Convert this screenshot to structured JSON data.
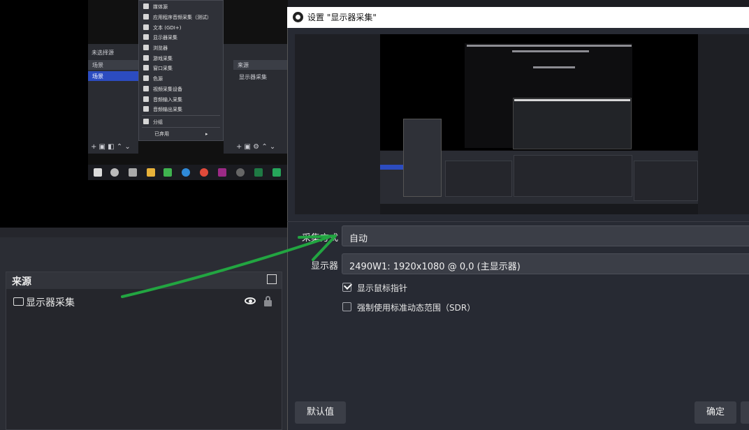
{
  "background": {
    "nested": {
      "scenes_header": "未选择源",
      "scenes_col": "场景",
      "scene_item": "场景",
      "sources_col": "来源",
      "source_item": "显示器采集"
    },
    "context_menu": {
      "items": [
        "媒体源",
        "应用程序音频采集（测试）",
        "文本 (GDI+)",
        "显示器采集",
        "浏览器",
        "游戏采集",
        "窗口采集",
        "色源",
        "视频采集设备",
        "音频输入采集",
        "音频输出采集",
        "分组",
        "已弃用"
      ]
    },
    "sources_dock": {
      "title": "来源",
      "item_label": "显示器采集"
    }
  },
  "dialog": {
    "title": "设置 \"显示器采集\"",
    "capture_method_label": "采集方式",
    "capture_method_value": "自动",
    "display_label": "显示器",
    "display_value": "2490W1: 1920x1080 @ 0,0 (主显示器)",
    "show_cursor_label": "显示鼠标指针",
    "show_cursor_checked": true,
    "force_sdr_label": "强制使用标准动态范围（SDR）",
    "force_sdr_checked": false,
    "defaults_button": "默认值",
    "ok_button": "确定"
  },
  "colors": {
    "accent_arrow": "#22a541",
    "selection": "#2c4cc0"
  }
}
